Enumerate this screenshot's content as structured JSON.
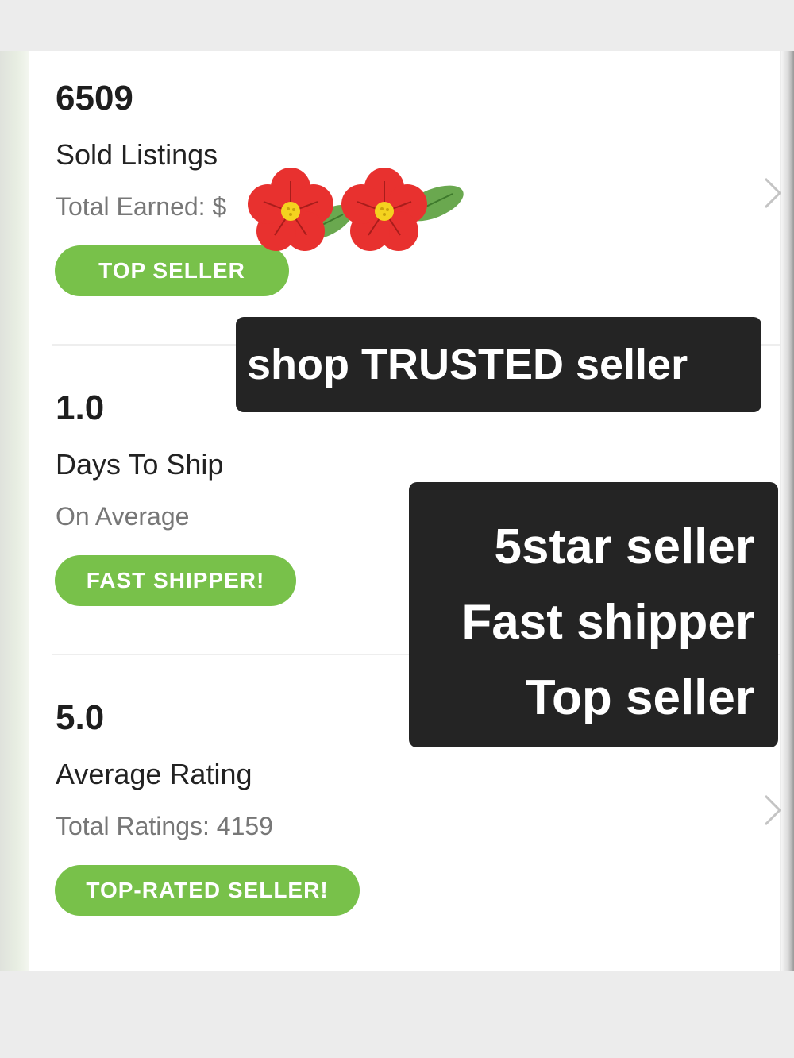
{
  "stats": [
    {
      "value": "6509",
      "label": "Sold Listings",
      "sub": "Total Earned: $",
      "badge": "TOP SELLER"
    },
    {
      "value": "1.0",
      "label": "Days To Ship",
      "sub": "On Average",
      "badge": "FAST SHIPPER!"
    },
    {
      "value": "5.0",
      "label": "Average Rating",
      "sub": "Total Ratings: 4159",
      "badge": "TOP-RATED SELLER!"
    }
  ],
  "overlays": {
    "trusted": "shop TRUSTED seller",
    "lines": [
      "5star seller",
      "Fast shipper",
      "Top seller"
    ]
  },
  "icons": {
    "chevron": "chevron-right-icon",
    "sticker": "flower-sticker"
  },
  "colors": {
    "badge": "#78c14a",
    "overlay": "#242424",
    "flower": "#e8312f"
  }
}
